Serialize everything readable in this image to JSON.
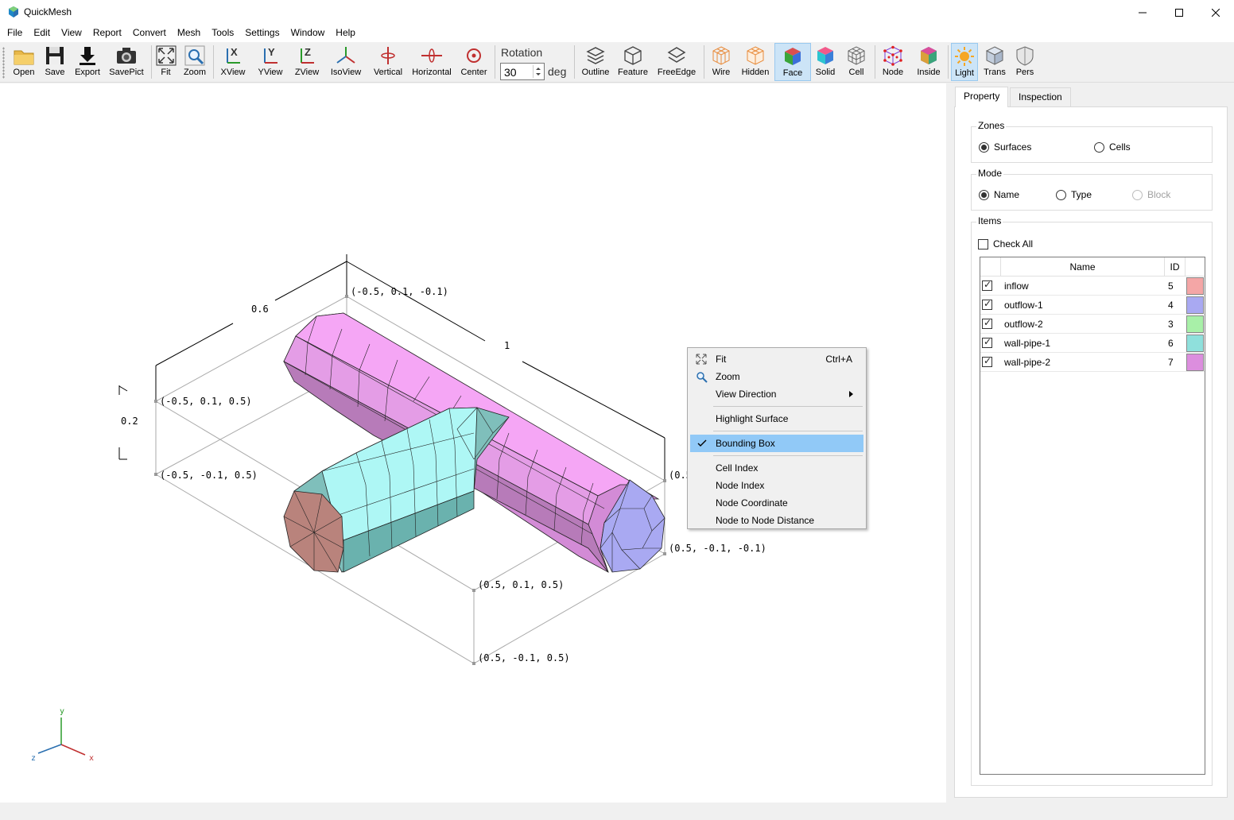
{
  "window": {
    "title": "QuickMesh"
  },
  "menu": [
    "File",
    "Edit",
    "View",
    "Report",
    "Convert",
    "Mesh",
    "Tools",
    "Settings",
    "Window",
    "Help"
  ],
  "toolbar": {
    "open": "Open",
    "save": "Save",
    "export": "Export",
    "savepict": "SavePict",
    "fit": "Fit",
    "zoom": "Zoom",
    "xview": "XView",
    "yview": "YView",
    "zview": "ZView",
    "isoview": "IsoView",
    "vertical": "Vertical",
    "horizontal": "Horizontal",
    "center": "Center",
    "rotation_label": "Rotation",
    "rotation_value": "30",
    "rotation_unit": "deg",
    "outline": "Outline",
    "feature": "Feature",
    "freeedge": "FreeEdge",
    "wire": "Wire",
    "hidden": "Hidden",
    "face": "Face",
    "solid": "Solid",
    "cell": "Cell",
    "node": "Node",
    "inside": "Inside",
    "light": "Light",
    "trans": "Trans",
    "pers": "Pers"
  },
  "viewport": {
    "labels": {
      "p1": "(-0.5, 0.1, -0.1)",
      "p2": "(-0.5, 0.1, 0.5)",
      "p3": "(-0.5, -0.1, 0.5)",
      "p4": "(0.5, -0.1, -0.1)",
      "p5": "(0.5, 0.1, 0.5)",
      "p6": "(0.5, -0.1, 0.5)",
      "p7_partial": "(0.5",
      "dim_depth": "0.6",
      "dim_width": "1",
      "dim_height": "0.2"
    },
    "axes": {
      "x": "x",
      "y": "y",
      "z": "z"
    }
  },
  "context_menu": {
    "fit": "Fit",
    "fit_shortcut": "Ctrl+A",
    "zoom": "Zoom",
    "view_direction": "View Direction",
    "highlight_surface": "Highlight Surface",
    "bounding_box": "Bounding Box",
    "cell_index": "Cell Index",
    "node_index": "Node Index",
    "node_coordinate": "Node Coordinate",
    "node_to_node_distance": "Node to Node Distance"
  },
  "panel": {
    "tabs": [
      "Property",
      "Inspection"
    ],
    "zones": {
      "title": "Zones",
      "surfaces": "Surfaces",
      "cells": "Cells",
      "selected": "Surfaces"
    },
    "mode": {
      "title": "Mode",
      "name": "Name",
      "type": "Type",
      "block": "Block",
      "selected": "Name"
    },
    "items": {
      "title": "Items",
      "check_all": "Check All",
      "headers": {
        "name": "Name",
        "id": "ID"
      },
      "rows": [
        {
          "name": "inflow",
          "id": "5",
          "color": "#f4a6a6",
          "checked": true
        },
        {
          "name": "outflow-1",
          "id": "4",
          "color": "#a9a9f2",
          "checked": true
        },
        {
          "name": "outflow-2",
          "id": "3",
          "color": "#a8f0a8",
          "checked": true
        },
        {
          "name": "wall-pipe-1",
          "id": "6",
          "color": "#8fe0dc",
          "checked": true
        },
        {
          "name": "wall-pipe-2",
          "id": "7",
          "color": "#dc8ede",
          "checked": true
        }
      ]
    }
  }
}
